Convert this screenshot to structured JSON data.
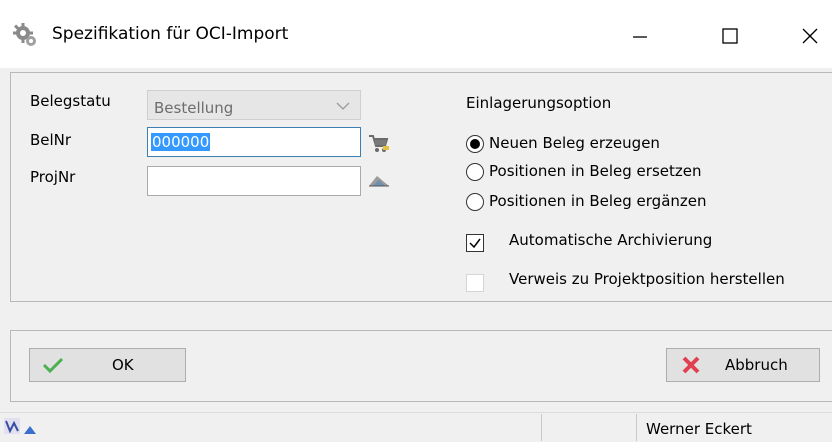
{
  "window": {
    "title": "Spezifikation für OCI-Import",
    "icon": "gear-icon",
    "controls": [
      "minimize-icon",
      "maximize-icon",
      "close-icon"
    ]
  },
  "form": {
    "belegstatus_label": "Belegstatu",
    "belegstatus_value": "Bestellung",
    "belnr_label": "BelNr",
    "belnr_value": "000000",
    "projnr_label": "ProjNr",
    "projnr_value": ""
  },
  "options": {
    "heading": "Einlagerungsoption",
    "radios": [
      {
        "label": "Neuen Beleg erzeugen",
        "checked": true
      },
      {
        "label": "Positionen in Beleg ersetzen",
        "checked": false
      },
      {
        "label": "Positionen in Beleg ergänzen",
        "checked": false
      }
    ],
    "checkboxes": [
      {
        "label": "Automatische Archivierung",
        "checked": true,
        "enabled": true
      },
      {
        "label": "Verweis zu Projektposition herstellen",
        "checked": false,
        "enabled": true
      }
    ]
  },
  "buttons": {
    "ok_label": "OK",
    "cancel_label": "Abbruch"
  },
  "statusbar": {
    "user": "Werner Eckert"
  },
  "colors": {
    "accent": "#3399ff",
    "ok_check": "#4caf50",
    "cancel_x": "#e04050"
  }
}
